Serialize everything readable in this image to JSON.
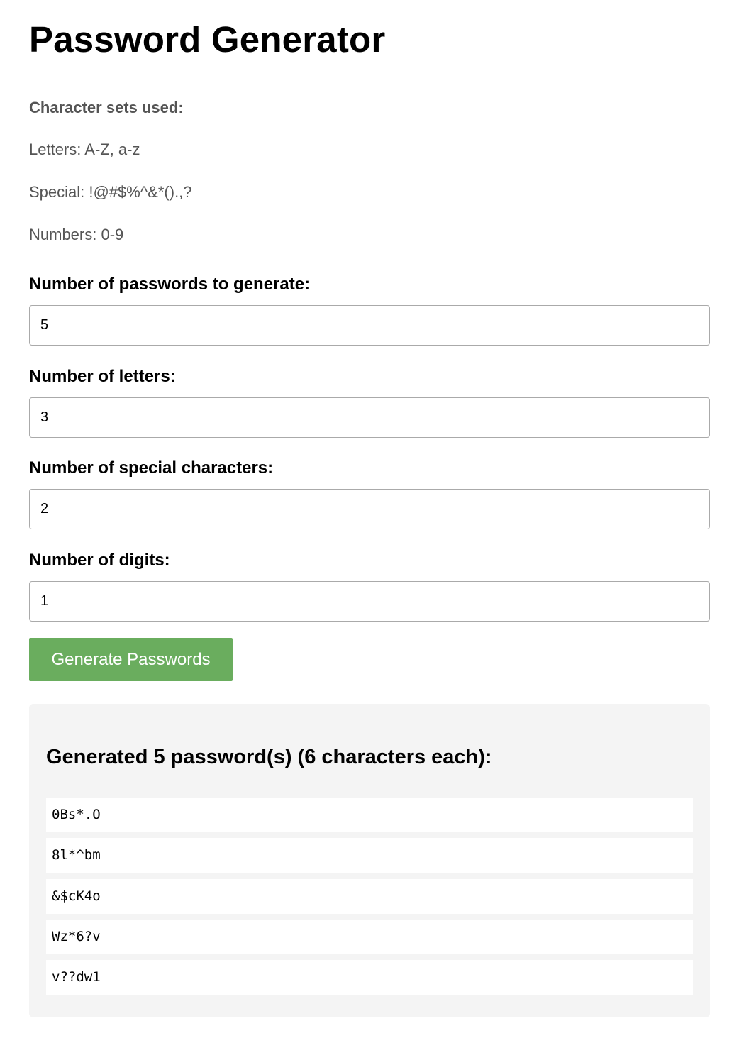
{
  "title": "Password Generator",
  "charsets": {
    "heading": "Character sets used:",
    "letters": "Letters: A-Z, a-z",
    "special": "Special: !@#$%^&*().,?",
    "numbers": "Numbers: 0-9"
  },
  "form": {
    "count": {
      "label": "Number of passwords to generate:",
      "value": "5"
    },
    "letters": {
      "label": "Number of letters:",
      "value": "3"
    },
    "special": {
      "label": "Number of special characters:",
      "value": "2"
    },
    "digits": {
      "label": "Number of digits:",
      "value": "1"
    },
    "button_label": "Generate Passwords",
    "button_color": "#6aad5e"
  },
  "results": {
    "heading": "Generated 5 password(s) (6 characters each):",
    "passwords": [
      "0Bs*.O",
      "8l*^bm",
      "&$cK4o",
      "Wz*6?v",
      "v??dw1"
    ]
  }
}
